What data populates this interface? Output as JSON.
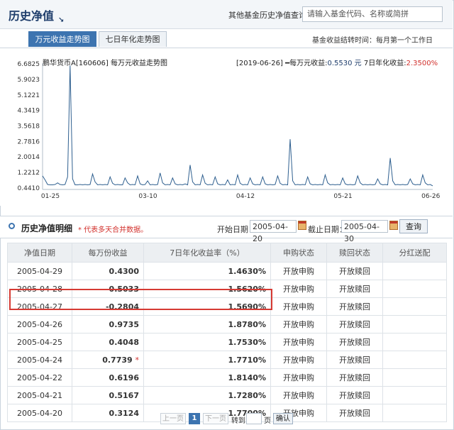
{
  "header": {
    "title": "历史净值",
    "arrow": "↘",
    "query_label": "其他基金历史净值查询：",
    "query_placeholder": "请输入基金代码、名称或简拼"
  },
  "tabs": [
    {
      "label": "万元收益走势图",
      "active": true
    },
    {
      "label": "七日年化走势图",
      "active": false
    }
  ],
  "settle_note": "基金收益结转时间：每月第一个工作日",
  "chart_header": {
    "title": "鹏华货币A[160606] 每万元收益走势图",
    "date": "[2019-06-26]",
    "income_label": "━每万元收益:",
    "income_value": "0.5530 元",
    "annual_label": "7日年化收益:",
    "annual_value": "2.3500%"
  },
  "chart_data": {
    "type": "line",
    "x_range": [
      "2019-01-21",
      "2019-06-26"
    ],
    "x_ticks": [
      "01-25",
      "03-10",
      "04-12",
      "05-21",
      "06-26"
    ],
    "y_ticks": [
      "0.4410",
      "1.2212",
      "2.0014",
      "2.7816",
      "3.5618",
      "4.3419",
      "5.1221",
      "5.9023",
      "6.6825"
    ],
    "ylim": [
      0.441,
      6.6825
    ],
    "series": [
      {
        "color": "#2e5f8f",
        "points": [
          [
            0,
            1.05
          ],
          [
            1,
            0.85
          ],
          [
            2,
            0.62
          ],
          [
            3,
            0.6
          ],
          [
            4,
            0.6
          ],
          [
            5,
            0.62
          ],
          [
            6,
            0.7
          ],
          [
            7,
            0.62
          ],
          [
            8,
            0.6
          ],
          [
            9,
            0.62
          ],
          [
            10,
            1.0
          ],
          [
            11,
            6.6
          ],
          [
            12,
            0.9
          ],
          [
            13,
            0.6
          ],
          [
            14,
            0.6
          ],
          [
            15,
            0.62
          ],
          [
            16,
            0.6
          ],
          [
            17,
            0.62
          ],
          [
            18,
            0.6
          ],
          [
            19,
            0.62
          ],
          [
            20,
            1.15
          ],
          [
            21,
            0.75
          ],
          [
            22,
            0.6
          ],
          [
            23,
            0.62
          ],
          [
            24,
            0.6
          ],
          [
            25,
            0.62
          ],
          [
            26,
            0.6
          ],
          [
            27,
            1.0
          ],
          [
            28,
            0.68
          ],
          [
            29,
            0.6
          ],
          [
            30,
            0.62
          ],
          [
            31,
            0.6
          ],
          [
            32,
            0.6
          ],
          [
            33,
            0.95
          ],
          [
            34,
            0.7
          ],
          [
            35,
            0.6
          ],
          [
            36,
            0.62
          ],
          [
            37,
            0.6
          ],
          [
            38,
            1.05
          ],
          [
            39,
            0.65
          ],
          [
            40,
            0.6
          ],
          [
            41,
            0.62
          ],
          [
            42,
            0.8
          ],
          [
            43,
            0.6
          ],
          [
            44,
            0.62
          ],
          [
            45,
            0.6
          ],
          [
            46,
            0.62
          ],
          [
            47,
            1.2
          ],
          [
            48,
            0.7
          ],
          [
            49,
            0.6
          ],
          [
            50,
            0.62
          ],
          [
            51,
            0.6
          ],
          [
            52,
            0.95
          ],
          [
            53,
            0.65
          ],
          [
            54,
            0.6
          ],
          [
            55,
            0.62
          ],
          [
            56,
            0.6
          ],
          [
            57,
            0.65
          ],
          [
            58,
            0.6
          ],
          [
            59,
            1.6
          ],
          [
            60,
            0.75
          ],
          [
            61,
            0.6
          ],
          [
            62,
            0.62
          ],
          [
            63,
            0.6
          ],
          [
            64,
            1.1
          ],
          [
            65,
            0.68
          ],
          [
            66,
            0.6
          ],
          [
            67,
            0.62
          ],
          [
            68,
            0.6
          ],
          [
            69,
            1.0
          ],
          [
            70,
            0.65
          ],
          [
            71,
            0.6
          ],
          [
            72,
            0.62
          ],
          [
            73,
            0.6
          ],
          [
            74,
            0.85
          ],
          [
            75,
            0.6
          ],
          [
            76,
            0.62
          ],
          [
            77,
            0.6
          ],
          [
            78,
            1.1
          ],
          [
            79,
            0.68
          ],
          [
            80,
            0.6
          ],
          [
            81,
            0.62
          ],
          [
            82,
            0.6
          ],
          [
            83,
            0.95
          ],
          [
            84,
            0.65
          ],
          [
            85,
            0.6
          ],
          [
            86,
            0.62
          ],
          [
            87,
            0.6
          ],
          [
            88,
            1.0
          ],
          [
            89,
            0.65
          ],
          [
            90,
            0.6
          ],
          [
            91,
            0.62
          ],
          [
            92,
            0.6
          ],
          [
            93,
            0.62
          ],
          [
            94,
            1.05
          ],
          [
            95,
            0.68
          ],
          [
            96,
            0.6
          ],
          [
            97,
            0.62
          ],
          [
            98,
            0.6
          ],
          [
            99,
            2.9
          ],
          [
            100,
            0.8
          ],
          [
            101,
            0.6
          ],
          [
            102,
            0.62
          ],
          [
            103,
            0.6
          ],
          [
            104,
            0.62
          ],
          [
            105,
            0.6
          ],
          [
            106,
            1.0
          ],
          [
            107,
            0.65
          ],
          [
            108,
            0.6
          ],
          [
            109,
            0.62
          ],
          [
            110,
            0.6
          ],
          [
            111,
            0.62
          ],
          [
            112,
            0.6
          ],
          [
            113,
            1.1
          ],
          [
            114,
            0.7
          ],
          [
            115,
            0.6
          ],
          [
            116,
            0.62
          ],
          [
            117,
            0.6
          ],
          [
            118,
            0.62
          ],
          [
            119,
            0.6
          ],
          [
            120,
            0.95
          ],
          [
            121,
            0.65
          ],
          [
            122,
            0.6
          ],
          [
            123,
            0.62
          ],
          [
            124,
            0.6
          ],
          [
            125,
            0.62
          ],
          [
            126,
            1.05
          ],
          [
            127,
            0.7
          ],
          [
            128,
            0.6
          ],
          [
            129,
            0.62
          ],
          [
            130,
            0.6
          ],
          [
            131,
            0.62
          ],
          [
            132,
            0.6
          ],
          [
            133,
            0.62
          ],
          [
            134,
            0.9
          ],
          [
            135,
            0.65
          ],
          [
            136,
            0.6
          ],
          [
            137,
            0.62
          ],
          [
            138,
            0.6
          ],
          [
            139,
            1.95
          ],
          [
            140,
            0.8
          ],
          [
            141,
            0.6
          ],
          [
            142,
            0.62
          ],
          [
            143,
            0.6
          ],
          [
            144,
            0.62
          ],
          [
            145,
            0.6
          ],
          [
            146,
            0.62
          ],
          [
            147,
            0.9
          ],
          [
            148,
            0.65
          ],
          [
            149,
            0.6
          ],
          [
            150,
            0.62
          ],
          [
            151,
            0.6
          ],
          [
            152,
            1.1
          ],
          [
            153,
            0.7
          ],
          [
            154,
            0.6
          ],
          [
            155,
            0.62
          ],
          [
            156,
            0.553
          ]
        ]
      }
    ],
    "grid": false
  },
  "detail": {
    "label": "历史净值明细",
    "hint": "* 代表多天合并数据。",
    "start_label": "开始日期：",
    "start_value": "2005-04-20",
    "end_label": "截止日期：",
    "end_value": "2005-04-30",
    "query_button": "查询"
  },
  "table": {
    "headers": [
      "净值日期",
      "每万份收益",
      "7日年化收益率（%）",
      "申购状态",
      "赎回状态",
      "分红送配"
    ],
    "rows": [
      {
        "date": "2005-04-29",
        "income": "0.4300",
        "star": "",
        "annual": "1.4630%",
        "buy": "开放申购",
        "redeem": "开放赎回",
        "bonus": ""
      },
      {
        "date": "2005-04-28",
        "income": "0.5033",
        "star": "",
        "annual": "1.5620%",
        "buy": "开放申购",
        "redeem": "开放赎回",
        "bonus": ""
      },
      {
        "date": "2005-04-27",
        "income": "-0.2804",
        "star": "",
        "annual": "1.5690%",
        "buy": "开放申购",
        "redeem": "开放赎回",
        "bonus": ""
      },
      {
        "date": "2005-04-26",
        "income": "0.9735",
        "star": "",
        "annual": "1.8780%",
        "buy": "开放申购",
        "redeem": "开放赎回",
        "bonus": ""
      },
      {
        "date": "2005-04-25",
        "income": "0.4048",
        "star": "",
        "annual": "1.7530%",
        "buy": "开放申购",
        "redeem": "开放赎回",
        "bonus": ""
      },
      {
        "date": "2005-04-24",
        "income": "0.7739",
        "star": "*",
        "annual": "1.7710%",
        "buy": "开放申购",
        "redeem": "开放赎回",
        "bonus": ""
      },
      {
        "date": "2005-04-22",
        "income": "0.6196",
        "star": "",
        "annual": "1.8140%",
        "buy": "开放申购",
        "redeem": "开放赎回",
        "bonus": ""
      },
      {
        "date": "2005-04-21",
        "income": "0.5167",
        "star": "",
        "annual": "1.7280%",
        "buy": "开放申购",
        "redeem": "开放赎回",
        "bonus": ""
      },
      {
        "date": "2005-04-20",
        "income": "0.3124",
        "star": "",
        "annual": "1.7700%",
        "buy": "开放申购",
        "redeem": "开放赎回",
        "bonus": ""
      }
    ]
  },
  "pager": {
    "prev": "上一页",
    "current": "1",
    "next": "下一页",
    "goto": "转到",
    "page_unit": "页",
    "confirm": "确认"
  }
}
